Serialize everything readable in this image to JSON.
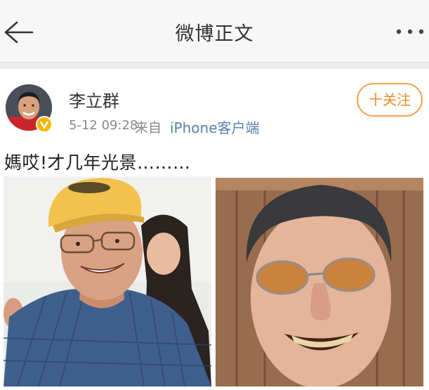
{
  "nav": {
    "back_icon": "back-arrow-icon",
    "title": "微博正文",
    "more_icon": "more-dots-icon"
  },
  "post": {
    "author": {
      "name": "李立群",
      "verified_badge_icon": "verified-v-icon",
      "verified_badge_color": "#f7b500"
    },
    "time": "5-12 09:28",
    "from_label": "来自",
    "source": "iPhone客户端",
    "follow_button": "十关注",
    "text": "媽哎!才几年光景………",
    "images": [
      {
        "description_icon": "photo-man-yellow-cap"
      },
      {
        "description_icon": "photo-man-sunglasses"
      }
    ]
  },
  "colors": {
    "accent_orange": "#f08a24",
    "link_blue": "#5b7fa6",
    "nav_background": "#f7f7f7"
  }
}
